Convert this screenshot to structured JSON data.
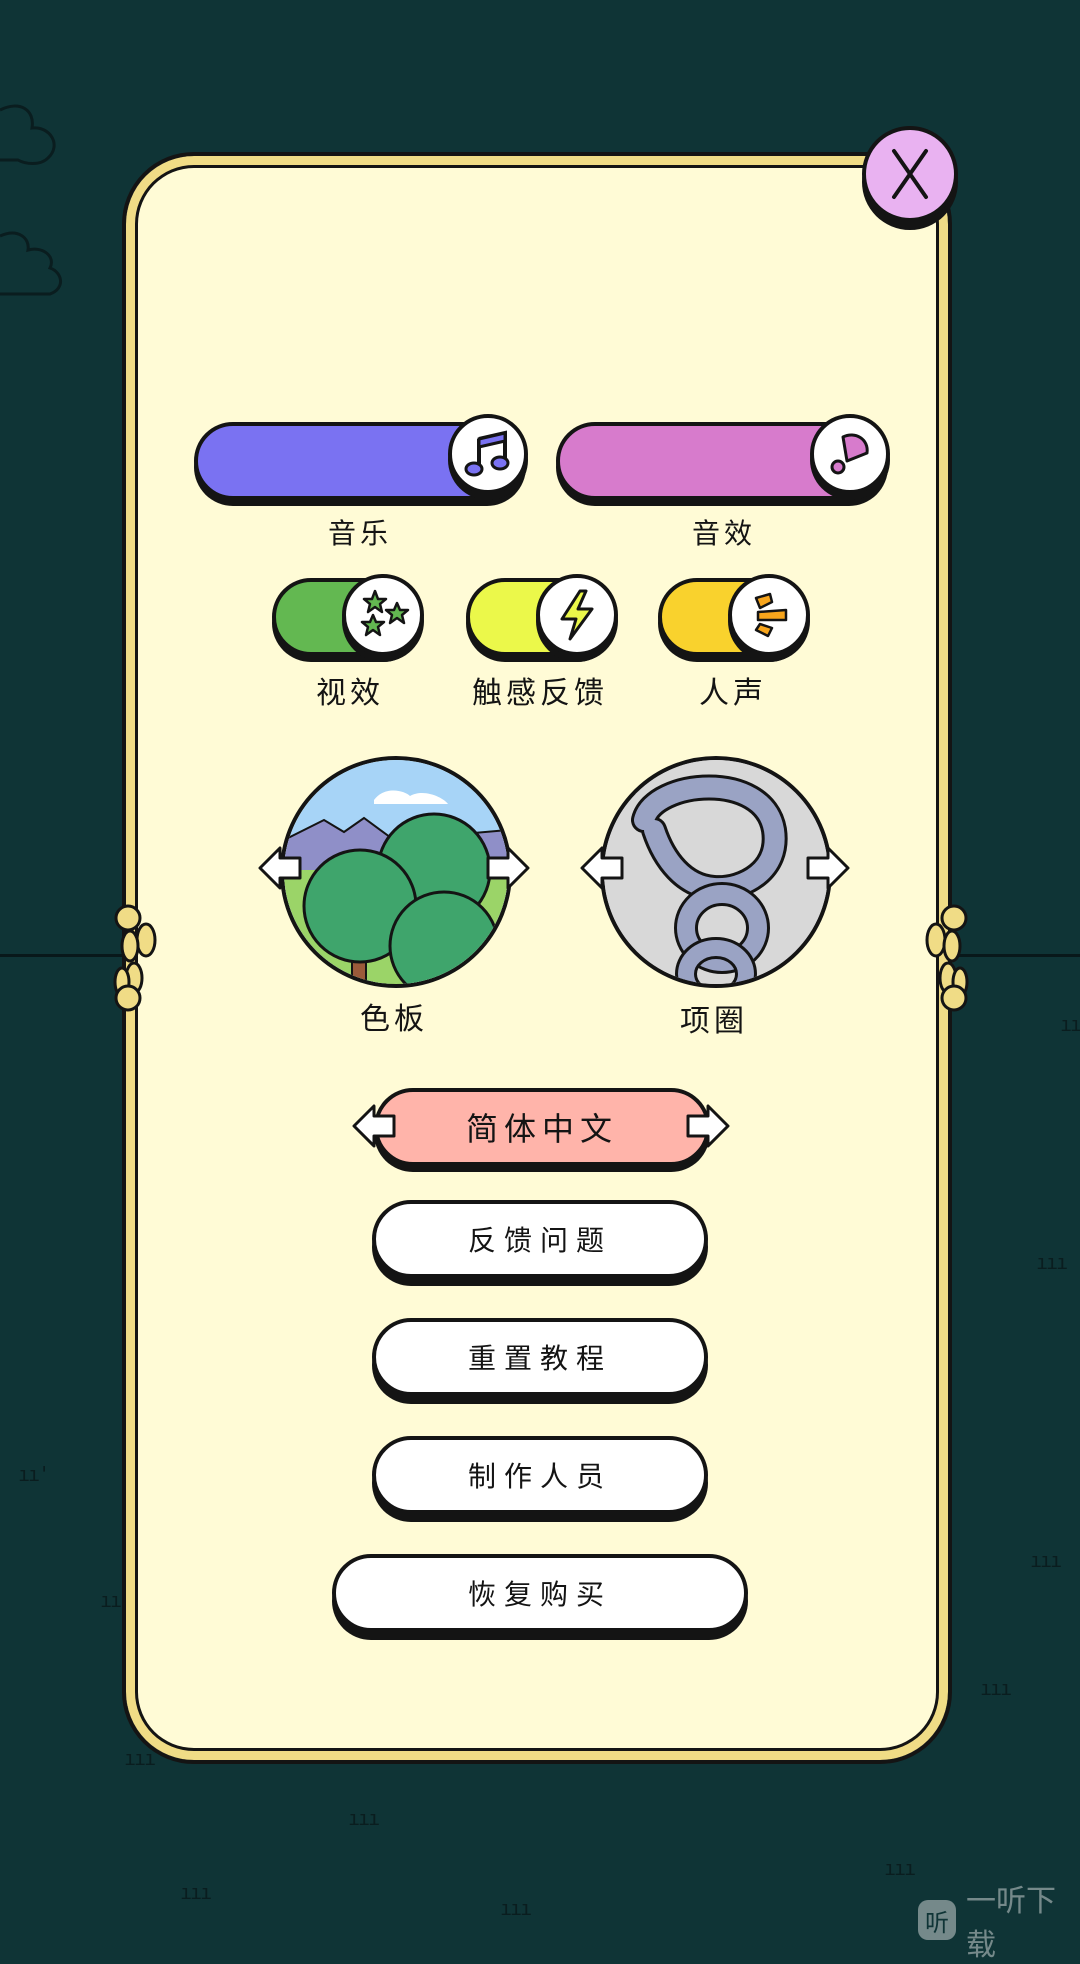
{
  "colors": {
    "background": "#0f3436",
    "panel": "#fffbd6",
    "music": "#7a72f2",
    "sfx": "#d77bcc",
    "visual": "#63b851",
    "haptic": "#ebf84a",
    "voice": "#f9d22d",
    "language": "#ffb4aa",
    "close": "#e9b2f1"
  },
  "settings": {
    "music": {
      "label": "音乐",
      "icon": "music-note-icon",
      "level": 1.0
    },
    "sfx": {
      "label": "音效",
      "icon": "megaphone-icon",
      "level": 1.0
    },
    "visual_effects": {
      "label": "视效",
      "icon": "stars-icon",
      "on": true
    },
    "haptics": {
      "label": "触感反馈",
      "icon": "lightning-icon",
      "on": true
    },
    "voice": {
      "label": "人声",
      "icon": "sound-waves-icon",
      "on": true
    }
  },
  "pickers": {
    "palette": {
      "label": "色板",
      "icon": "forest-landscape-icon"
    },
    "collar": {
      "label": "项圈",
      "icon": "chain-collar-icon"
    }
  },
  "language": {
    "value": "简体中文"
  },
  "buttons": {
    "feedback": "反馈问题",
    "reset_tutorial": "重置教程",
    "credits": "制作人员",
    "restore_purchases": "恢复购买"
  },
  "watermark": {
    "badge": "听",
    "text": "一听下载"
  }
}
